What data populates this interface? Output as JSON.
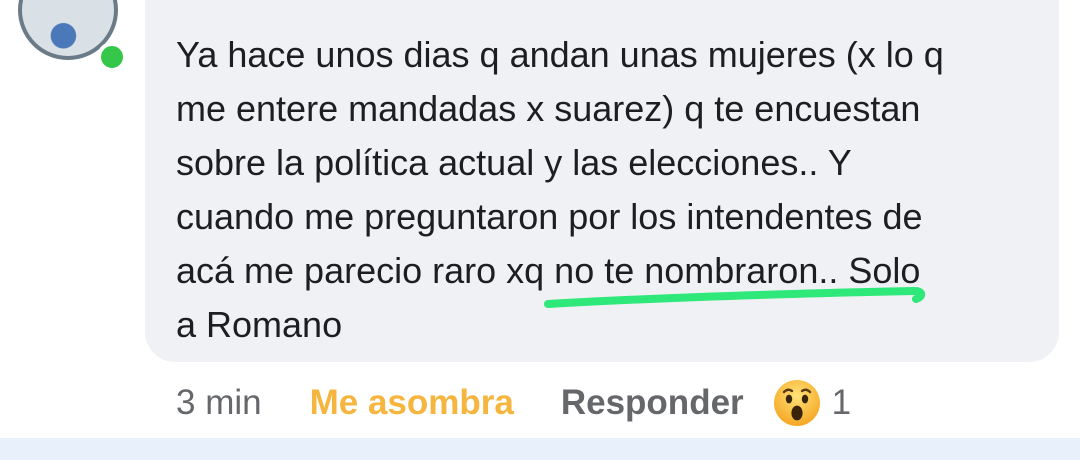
{
  "comment": {
    "lines": [
      "Ya hace unos dias q andan unas mujeres (x lo q",
      "me entere mandadas x suarez) q te encuestan",
      "sobre la política actual y las elecciones.. Y",
      "cuando me preguntaron por los  intendentes de",
      "acá me parecio raro xq no te nombraron.. Solo",
      "a Romano"
    ],
    "highlight_color": "#2ee87a"
  },
  "actions": {
    "timestamp": "3 min",
    "reaction_label": "Me asombra",
    "reaction_label_color": "#f5b53e",
    "reply_label": "Responder",
    "reaction_icon": "wow-emoji-icon",
    "reaction_count": "1"
  },
  "colors": {
    "bubble": "#eff1f5",
    "online": "#35c74a",
    "text": "#1c1e21",
    "muted": "#65676b"
  }
}
